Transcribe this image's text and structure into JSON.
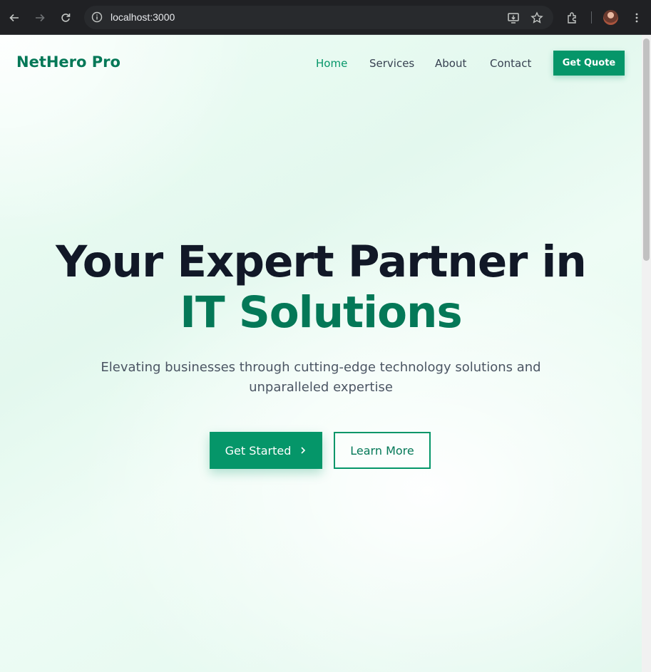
{
  "browser": {
    "url": "localhost:3000",
    "icons": [
      "back-icon",
      "forward-icon",
      "reload-icon",
      "site-info-icon",
      "install-app-icon",
      "bookmark-star-icon",
      "extensions-icon",
      "profile-avatar",
      "menu-icon"
    ]
  },
  "nav": {
    "brand": "NetHero Pro",
    "links": [
      "Home",
      "Services",
      "About",
      "Contact"
    ],
    "active": "Home",
    "cta": "Get Quote"
  },
  "hero": {
    "title_line1": "Your Expert Partner in",
    "title_line2": "IT Solutions",
    "subtitle_line1": "Elevating businesses through cutting-edge technology solutions and",
    "subtitle_line2": "unparalleled expertise",
    "primary_button": "Get Started",
    "secondary_button": "Learn More"
  },
  "colors": {
    "accent": "#059669",
    "accent_dark": "#047857",
    "heading": "#111827",
    "body_text": "#4b5563"
  }
}
